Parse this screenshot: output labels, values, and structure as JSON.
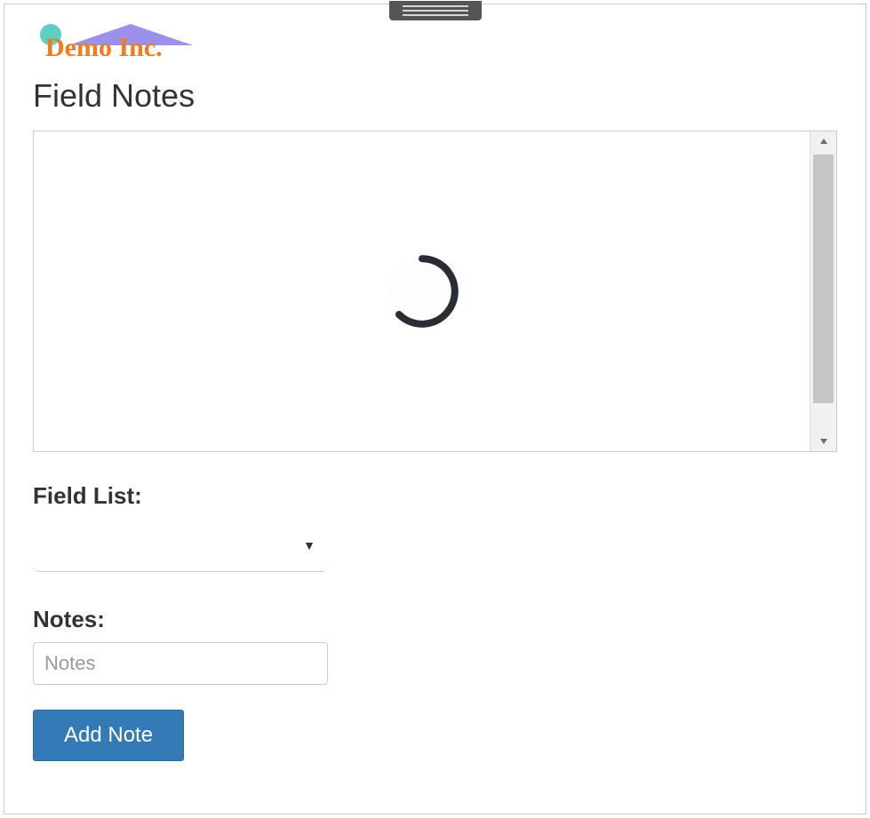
{
  "logo": {
    "text": "Demo Inc.",
    "accent_color": "#f07b1f",
    "roof_color": "#8a7de6",
    "dot_color": "#5bd1c4"
  },
  "page": {
    "title": "Field Notes"
  },
  "map": {
    "loading": true
  },
  "form": {
    "field_list_label": "Field List:",
    "field_list_value": "",
    "notes_label": "Notes:",
    "notes_value": "",
    "notes_placeholder": "Notes",
    "add_button_label": "Add Note"
  },
  "colors": {
    "primary_button_bg": "#337ab7",
    "primary_button_text": "#ffffff",
    "border": "#cccccc",
    "text": "#333333"
  }
}
